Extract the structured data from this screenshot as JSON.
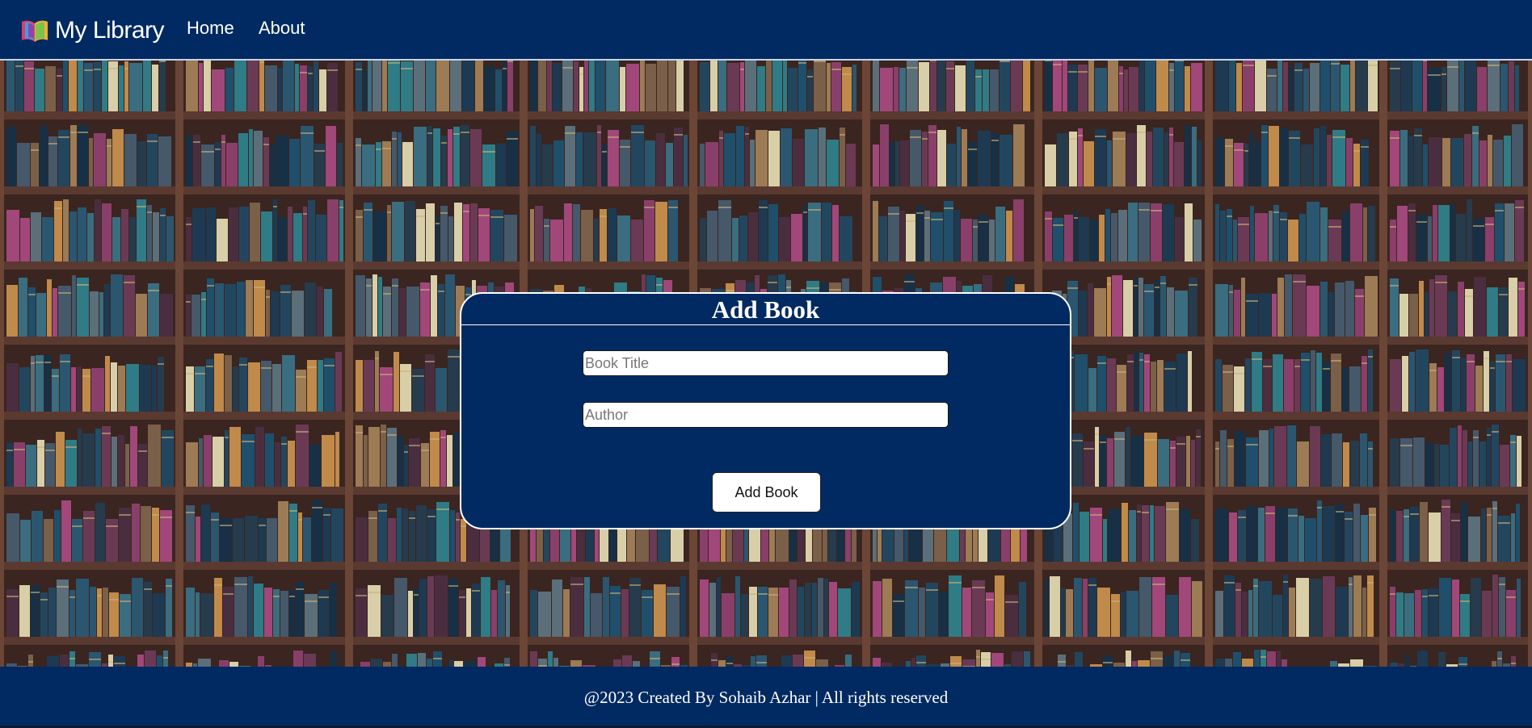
{
  "navbar": {
    "brand_name": "My Library",
    "brand_icon": "books-icon",
    "links": [
      {
        "label": "Home"
      },
      {
        "label": "About"
      }
    ]
  },
  "form": {
    "title": "Add Book",
    "book_title_placeholder": "Book Title",
    "author_placeholder": "Author",
    "submit_label": "Add Book"
  },
  "footer": {
    "text": "@2023 Created By Sohaib Azhar | All rights reserved"
  },
  "colors": {
    "primary": "#002a61",
    "text": "#ffffff",
    "background_image": "bookshelves"
  }
}
